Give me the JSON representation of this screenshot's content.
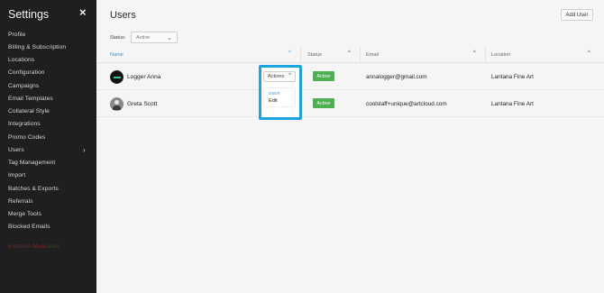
{
  "sidebar": {
    "title": "Settings",
    "close_icon": "×",
    "items": [
      {
        "label": "Profile"
      },
      {
        "label": "Billing & Subscription"
      },
      {
        "label": "Locations"
      },
      {
        "label": "Configuration"
      },
      {
        "label": "Campaigns"
      },
      {
        "label": "Email Templates"
      },
      {
        "label": "Collateral Style"
      },
      {
        "label": "Integrations"
      },
      {
        "label": "Promo Codes"
      },
      {
        "label": "Users",
        "has_submenu": true,
        "chevron_icon": "›"
      },
      {
        "label": "Tag Management"
      },
      {
        "label": "Import"
      },
      {
        "label": "Batches & Exports"
      },
      {
        "label": "Referrals"
      },
      {
        "label": "Merge Tools"
      },
      {
        "label": "Blocked Emails"
      }
    ],
    "danger_item": "Extreme Measures"
  },
  "main": {
    "title": "Users",
    "add_button": "Add User",
    "filter": {
      "label": "Status:",
      "value": "Active",
      "chevron_icon": "⌄"
    },
    "columns": [
      "Name",
      "Status",
      "Email",
      "Location"
    ],
    "sort_icon": "^",
    "rows": [
      {
        "name": "Logger Anna",
        "status": "Active",
        "email": "annalogger@gmail.com",
        "location": "Lantana Fine Art"
      },
      {
        "name": "Greta Scott",
        "status": "Active",
        "email": "coolstaff+unique@artcloud.com",
        "location": "Lantana Fine Art"
      }
    ],
    "actions": {
      "button_label": "Actions",
      "chevron_icon": "^",
      "menu_group": "USER",
      "menu_items": [
        "Edit"
      ]
    }
  },
  "colors": {
    "sidebar_bg": "#1f1f1f",
    "accent": "#3a8fd1",
    "status_active": "#4caf50",
    "highlight": "#1da3e0",
    "danger": "#7a2a22"
  }
}
